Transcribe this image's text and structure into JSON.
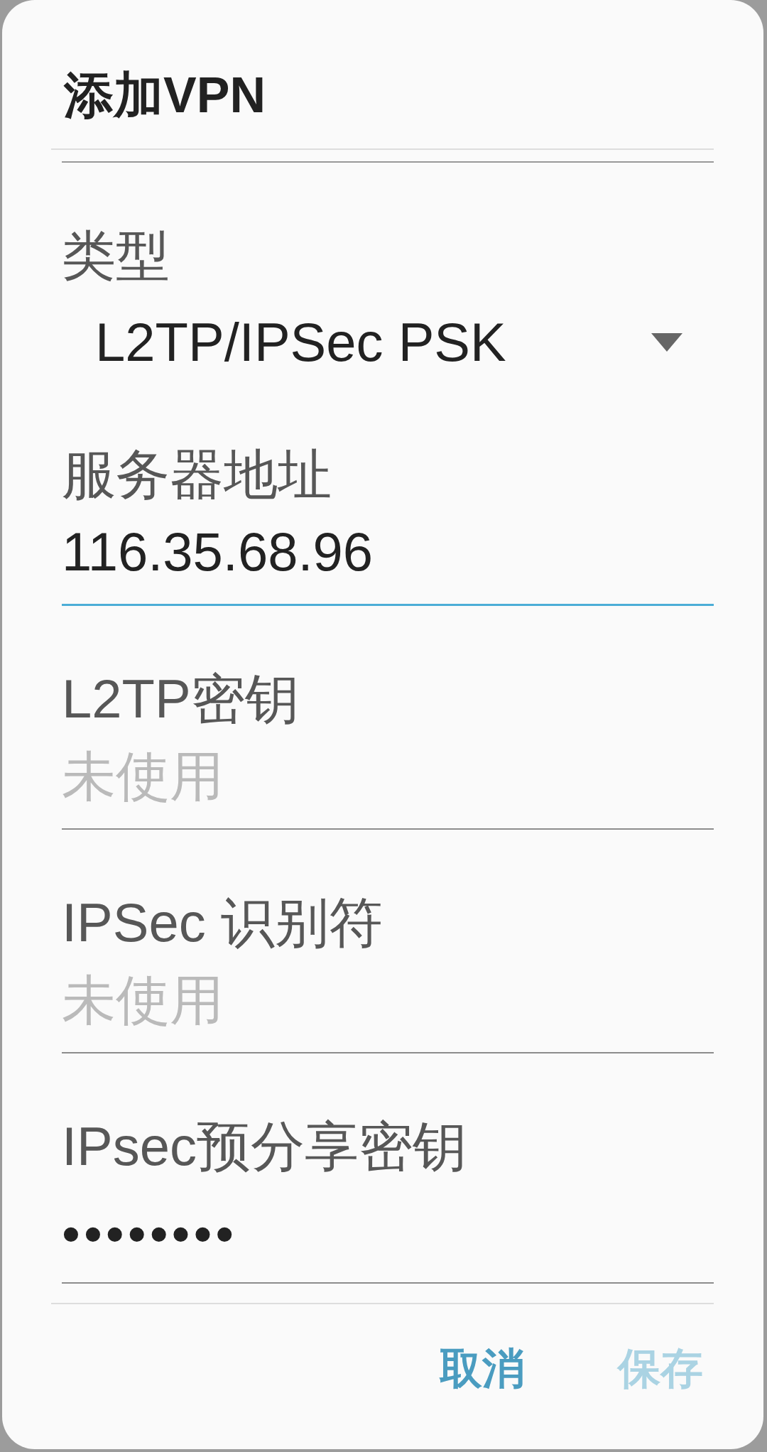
{
  "dialog": {
    "title": "添加VPN"
  },
  "fields": [
    {
      "kind": "dropdown",
      "label": "类型",
      "value": "L2TP/IPSec PSK",
      "focused": false
    },
    {
      "kind": "text",
      "label": "服务器地址",
      "value": "116.35.68.96",
      "focused": true
    },
    {
      "kind": "text",
      "label": "L2TP密钥",
      "placeholder": "未使用",
      "focused": false
    },
    {
      "kind": "text",
      "label": "IPSec 识别符",
      "placeholder": "未使用",
      "focused": false
    },
    {
      "kind": "password",
      "label": "IPsec预分享密钥",
      "value": "••••••••",
      "focused": false
    }
  ],
  "buttons": [
    {
      "label": "取消",
      "disabled": false
    },
    {
      "label": "保存",
      "disabled": true
    }
  ]
}
